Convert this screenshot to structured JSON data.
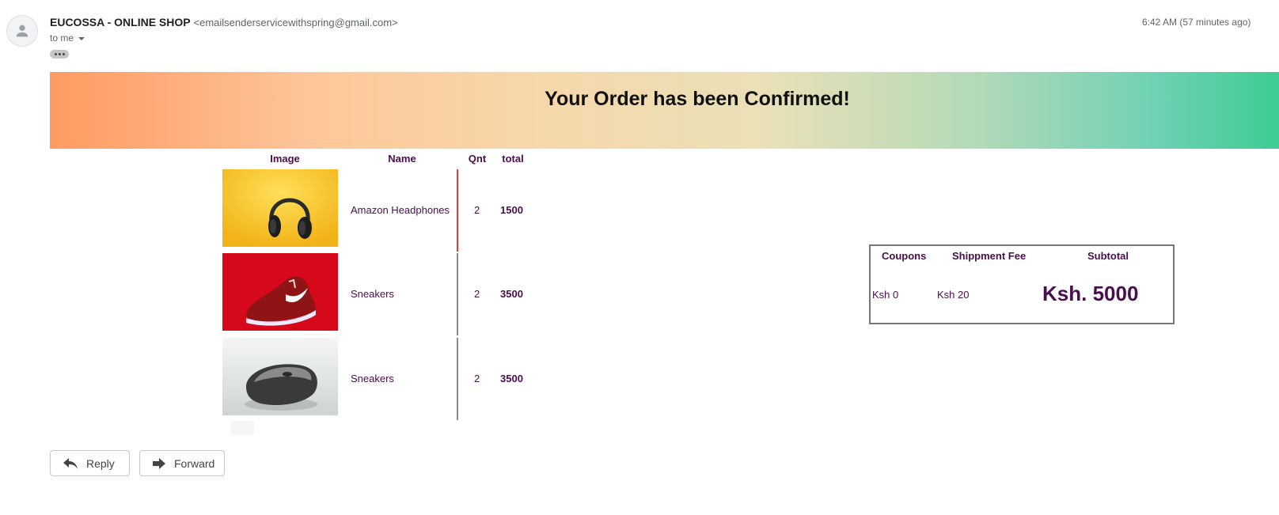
{
  "email": {
    "sender_name": "EUCOSSA - ONLINE SHOP",
    "sender_email": "<emailsenderservicewithspring@gmail.com>",
    "to_label": "to me",
    "time": "6:42 AM (57 minutes ago)"
  },
  "banner": {
    "title": "Your Order has been Confirmed!"
  },
  "order": {
    "headers": {
      "image": "Image",
      "name": "Name",
      "qnt": "Qnt",
      "total": "total"
    },
    "items": [
      {
        "name": "Amazon Headphones",
        "qnt": "2",
        "total": "1500",
        "image": "headphones-image"
      },
      {
        "name": "Sneakers",
        "qnt": "2",
        "total": "3500",
        "image": "sneaker-image"
      },
      {
        "name": "Sneakers",
        "qnt": "2",
        "total": "3500",
        "image": "mouse-image"
      }
    ]
  },
  "summary": {
    "headers": {
      "coupons": "Coupons",
      "shipment": "Shippment Fee",
      "subtotal": "Subtotal"
    },
    "coupons": "Ksh 0",
    "shipment": "Ksh 20",
    "subtotal": "Ksh. 5000"
  },
  "actions": {
    "reply": "Reply",
    "forward": "Forward"
  },
  "colors": {
    "accent": "#4a0d4e",
    "divider_active": "#e53935",
    "divider": "#8a8a8a"
  }
}
